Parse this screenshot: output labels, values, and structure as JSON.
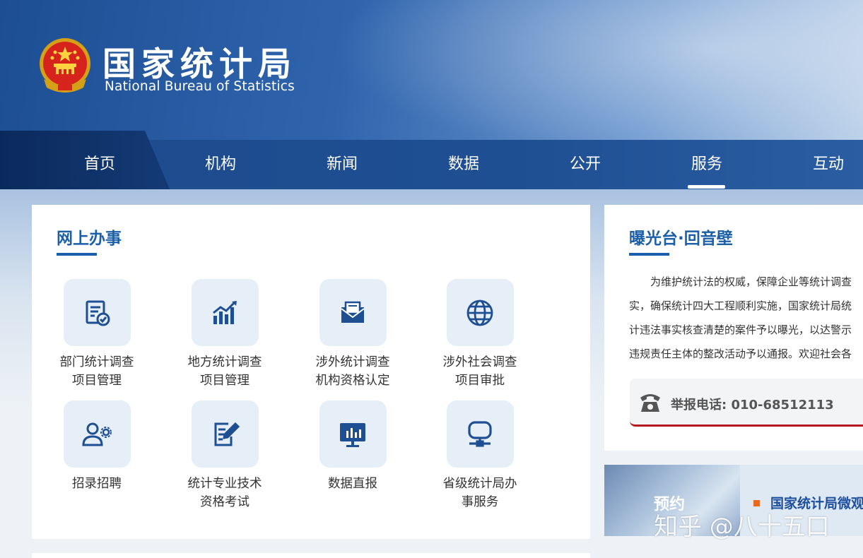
{
  "header": {
    "title": "国家统计局",
    "subtitle": "National Bureau of Statistics"
  },
  "nav": {
    "items": [
      {
        "label": "首页"
      },
      {
        "label": "机构"
      },
      {
        "label": "新闻"
      },
      {
        "label": "数据"
      },
      {
        "label": "公开"
      },
      {
        "label": "服务"
      },
      {
        "label": "互动"
      }
    ],
    "active": "服务"
  },
  "online_services": {
    "title": "网上办事",
    "items": [
      {
        "label": "部门统计调查\n项目管理",
        "icon": "document-check-icon"
      },
      {
        "label": "地方统计调查\n项目管理",
        "icon": "bar-chart-trend-icon"
      },
      {
        "label": "涉外统计调查\n机构资格认定",
        "icon": "envelope-icon"
      },
      {
        "label": "涉外社会调查\n项目审批",
        "icon": "globe-icon"
      },
      {
        "label": "招录招聘",
        "icon": "user-gear-icon"
      },
      {
        "label": "统计专业技术\n资格考试",
        "icon": "edit-document-icon"
      },
      {
        "label": "数据直报",
        "icon": "monitor-chart-icon"
      },
      {
        "label": "省级统计局办\n事服务",
        "icon": "terminal-icon"
      }
    ]
  },
  "exposure": {
    "title": "曝光台·回音壁",
    "paragraph_lines": [
      "为维护统计法的权威，保障企业等统计调查",
      "实，确保统计四大工程顺利实施，国家统计局统",
      "计违法事实核查清楚的案件予以曝光，以达警示",
      "违规责任主体的整改活动予以通报。欢迎社会各"
    ],
    "hotline": "举报电话: 010-68512113"
  },
  "banner": {
    "photo_text": "预约",
    "text": "国家统计局微观"
  },
  "watermark": "知乎 @八十五口",
  "colors": {
    "accent": "#1b5fa8",
    "nav_bg": "#1f4f93",
    "hotline_border": "#b3191f",
    "icon_tile_bg": "#e6eef8"
  }
}
